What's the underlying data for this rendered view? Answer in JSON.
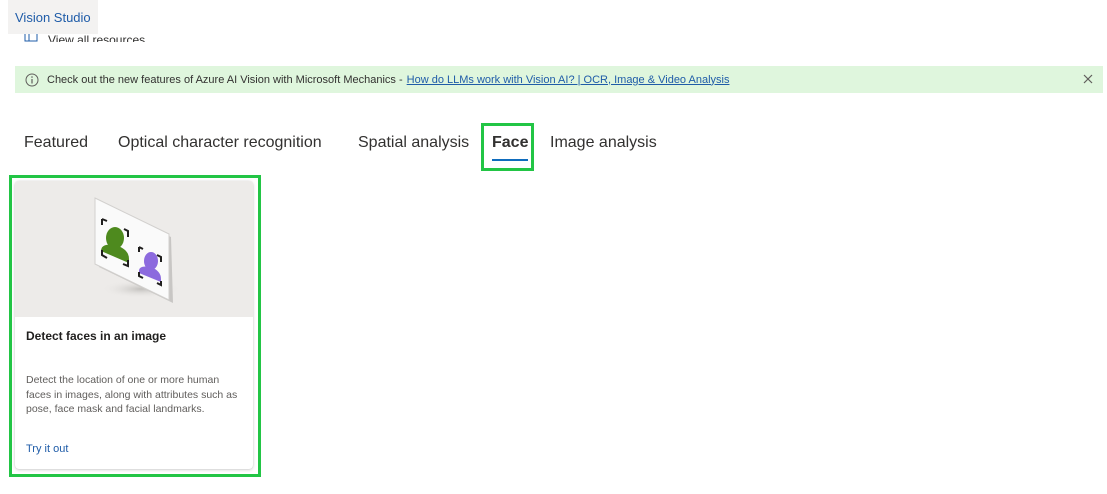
{
  "header": {
    "brand": "Vision Studio",
    "view_all_resources": "View all resources"
  },
  "banner": {
    "text": "Check out the new features of Azure AI Vision with Microsoft Mechanics -",
    "link_text": "How do LLMs work with Vision AI? | OCR, Image & Video Analysis",
    "background_color": "#dff6dd"
  },
  "tabs": [
    {
      "label": "Featured",
      "active": false
    },
    {
      "label": "Optical character recognition",
      "active": false
    },
    {
      "label": "Spatial analysis",
      "active": false
    },
    {
      "label": "Face",
      "active": true
    },
    {
      "label": "Image analysis",
      "active": false
    }
  ],
  "cards": [
    {
      "title": "Detect faces in an image",
      "description": "Detect the location of one or more human faces in images, along with attributes such as pose, face mask and facial landmarks.",
      "cta": "Try it out",
      "illustration": "face-detection-illustration"
    }
  ],
  "colors": {
    "accent": "#0f6cbd",
    "link": "#1f5ca8",
    "highlight": "#22c545"
  }
}
